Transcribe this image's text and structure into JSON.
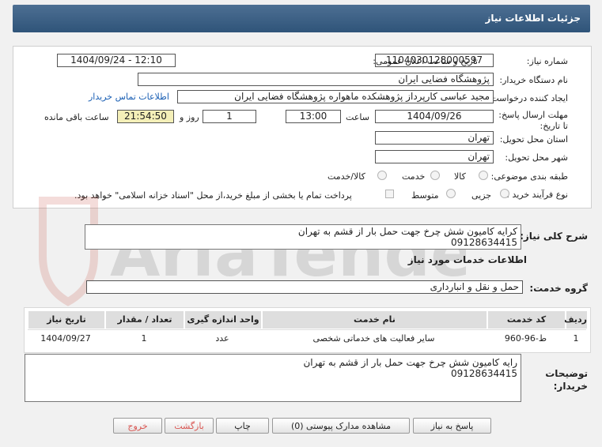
{
  "page_title": "جزئیات اطلاعات نیاز",
  "fields": {
    "need_number_label": "شماره نیاز:",
    "need_number": "1104030128000597",
    "announce_label": "تاریخ و ساعت اعلان عمومی:",
    "announce_value": "1404/09/24 - 12:10",
    "buyer_org_label": "نام دستگاه خریدار:",
    "buyer_org": "پژوهشگاه فضایی ایران",
    "requester_label": "ایجاد کننده درخواست:",
    "requester": "مجید عباسی کارپرداز پژوهشکده ماهواره پژوهشگاه فضایی ایران",
    "contact_link": "اطلاعات تماس خریدار",
    "deadline_label": "مهلت ارسال پاسخ: تا تاریخ:",
    "deadline_date": "1404/09/26",
    "time_label": "ساعت",
    "deadline_time": "13:00",
    "days_value": "1",
    "days_label": "روز و",
    "remaining_time": "21:54:50",
    "remaining_label": "ساعت باقی مانده",
    "province_label": "استان محل تحویل:",
    "province": "تهران",
    "city_label": "شهر محل تحویل:",
    "city": "تهران",
    "category_label": "طبقه بندی موضوعی:",
    "category_options": [
      "کالا",
      "خدمت",
      "کالا/خدمت"
    ],
    "process_label": "نوع فرآیند خرید :",
    "process_options": [
      "جزیی",
      "متوسط"
    ],
    "payment_note": "پرداخت تمام یا بخشی از مبلغ خرید،از محل \"اسناد خزانه اسلامی\" خواهد بود."
  },
  "summary": {
    "label": "شرح کلی نیاز:",
    "line1": "کرایه کامیون شش چرخ جهت حمل بار از قشم به تهران",
    "line2": "09128634415"
  },
  "services": {
    "section_title": "اطلاعات خدمات مورد نیاز",
    "group_label": "گروه خدمت:",
    "group_value": "حمل و نقل و انبارداری",
    "columns": [
      "ردیف",
      "کد خدمت",
      "نام خدمت",
      "واحد اندازه گیری",
      "تعداد / مقدار",
      "تاریخ نیاز"
    ],
    "rows": [
      [
        "1",
        "ط-96-960",
        "سایر فعالیت های خدماتی شخصی",
        "عدد",
        "1",
        "1404/09/27"
      ]
    ]
  },
  "buyer_notes": {
    "label": "توضیحات خریدار:",
    "line1": "رایه کامیون شش چرخ جهت حمل بار از قشم به تهران",
    "line2": "09128634415"
  },
  "buttons": {
    "reply": "پاسخ به نیاز",
    "attachments": "مشاهده مدارک پیوستی (0)",
    "print": "چاپ",
    "back": "بازگشت",
    "exit": "خروج"
  },
  "watermark": "AriaTender.net"
}
